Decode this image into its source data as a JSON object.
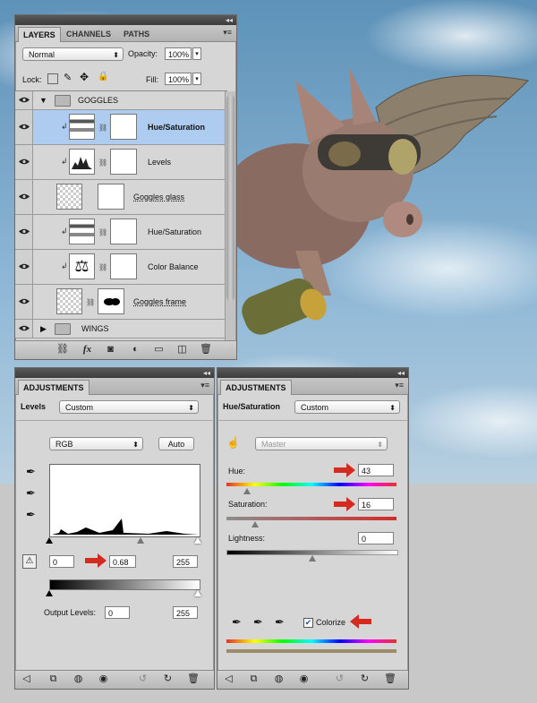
{
  "layers_panel": {
    "tabs": [
      "LAYERS",
      "CHANNELS",
      "PATHS"
    ],
    "blend_mode": "Normal",
    "opacity_label": "Opacity:",
    "opacity_value": "100%",
    "lock_label": "Lock:",
    "fill_label": "Fill:",
    "fill_value": "100%",
    "group_top": "GOGGLES",
    "layers": [
      {
        "name": "Hue/Saturation",
        "selected": true
      },
      {
        "name": "Levels"
      },
      {
        "name": "Goggles glass"
      },
      {
        "name": "Hue/Saturation"
      },
      {
        "name": "Color Balance"
      },
      {
        "name": "Goggles frame"
      }
    ],
    "group_bottom": "WINGS"
  },
  "levels_panel": {
    "tab": "ADJUSTMENTS",
    "title": "Levels",
    "preset": "Custom",
    "channel": "RGB",
    "auto_label": "Auto",
    "input_black": "0",
    "input_gamma": "0.68",
    "input_white": "255",
    "output_label": "Output Levels:",
    "output_black": "0",
    "output_white": "255"
  },
  "hue_panel": {
    "tab": "ADJUSTMENTS",
    "title": "Hue/Saturation",
    "preset": "Custom",
    "range": "Master",
    "hue_label": "Hue:",
    "hue_value": "43",
    "saturation_label": "Saturation:",
    "saturation_value": "16",
    "lightness_label": "Lightness:",
    "lightness_value": "0",
    "colorize_label": "Colorize",
    "colorize_checked": true
  },
  "colors": {
    "selection": "#aeccf0",
    "arrow": "#d42a1f",
    "panel": "#d6d6d6"
  }
}
